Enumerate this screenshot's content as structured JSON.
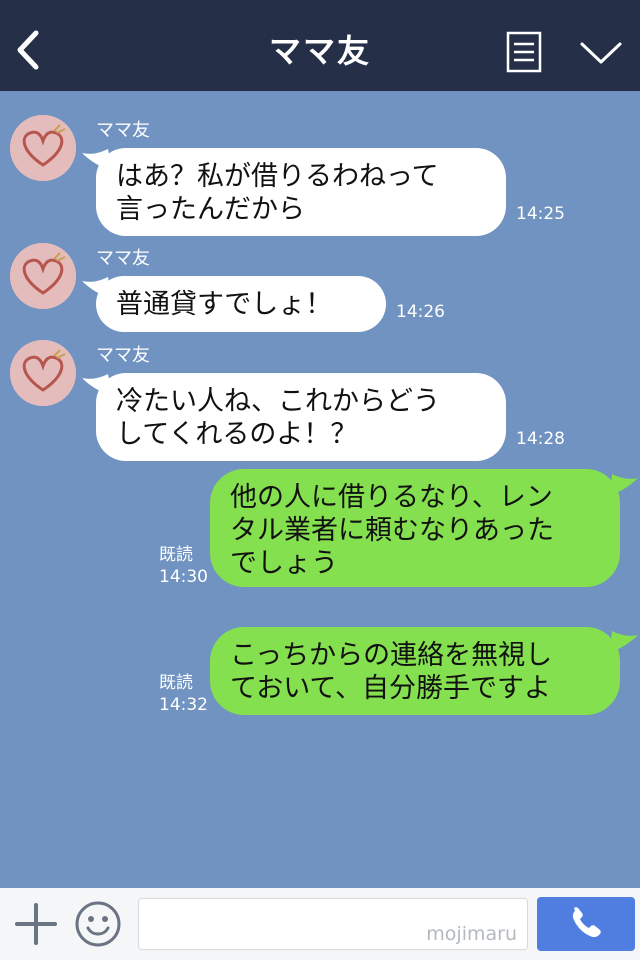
{
  "header": {
    "title": "ママ友",
    "back_icon": "chevron-left-icon",
    "notes_icon": "notes-icon",
    "menu_icon": "chevron-down-icon"
  },
  "messages": [
    {
      "sender": "ママ友",
      "text": "はあ？私が借りるわねって\n言ったんだから",
      "time": "14:25",
      "direction": "incoming"
    },
    {
      "sender": "ママ友",
      "text": "普通貸すでしょ！",
      "time": "14:26",
      "direction": "incoming"
    },
    {
      "sender": "ママ友",
      "text": "冷たい人ね、これからどう\nしてくれるのよ！？",
      "time": "14:28",
      "direction": "incoming"
    },
    {
      "text": "他の人に借りるなり、レン\nタル業者に頼むなりあった\nでしょう",
      "read": "既読",
      "time": "14:30",
      "direction": "outgoing"
    },
    {
      "text": "こっちからの連絡を無視し\nておいて、自分勝手ですよ",
      "read": "既読",
      "time": "14:32",
      "direction": "outgoing"
    }
  ],
  "footer": {
    "plus_icon": "plus-icon",
    "emoji_icon": "smiley-icon",
    "input_value": "",
    "watermark": "mojimaru",
    "call_icon": "phone-icon"
  },
  "colors": {
    "header_bg": "#253048",
    "chat_bg": "#7093c2",
    "incoming_bubble": "#ffffff",
    "outgoing_bubble": "#84e04e",
    "call_button": "#4f7ee0"
  }
}
